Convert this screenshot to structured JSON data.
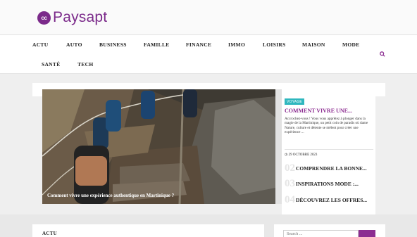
{
  "brand": {
    "logo_badge": "cc",
    "logo_text": "Paysapt",
    "accent": "#7b2a8a"
  },
  "nav": {
    "items": [
      "ACTU",
      "AUTO",
      "BUSINESS",
      "FAMILLE",
      "FINANCE",
      "IMMO",
      "LOISIRS",
      "MAISON",
      "MODE",
      "SANTÉ",
      "TECH"
    ],
    "search_icon": "search-icon"
  },
  "slider": {
    "caption": "Comment vivre une expérience authentique en Martinique ?"
  },
  "featured": {
    "category": "VOYAGE",
    "title": "COMMENT VIVRE UNE...",
    "excerpt": "Accrochez-vous ! Vous vous apprêtez à plonger dans la magie de la Martinique, un petit coin de paradis où dame Nature, culture et détente se mêlent pour créer une expérience ...",
    "date": "29 OCTOBRE 2023",
    "badge_color": "#2fb7be"
  },
  "list": [
    {
      "num": "02",
      "title": "COMPRENDRE LA BONNE..."
    },
    {
      "num": "03",
      "title": "INSPIRATIONS MODE :..."
    },
    {
      "num": "04",
      "title": "DÉCOUVREZ LES OFFRES..."
    }
  ],
  "section": {
    "label": "ACTU"
  },
  "search": {
    "placeholder": "Search ..."
  }
}
